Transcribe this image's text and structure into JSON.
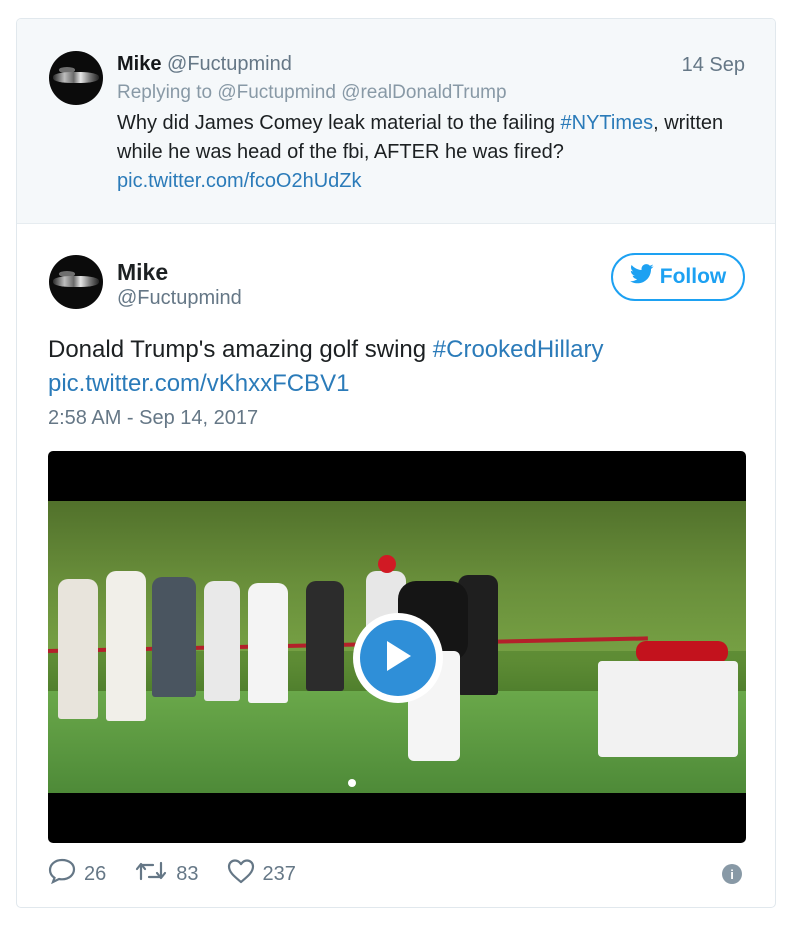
{
  "parent_tweet": {
    "name": "Mike",
    "handle": "@Fuctupmind",
    "date": "14 Sep",
    "replying_prefix": "Replying to",
    "replying_to_1": "@Fuctupmind",
    "replying_to_2": "@realDonaldTrump",
    "text_before": "Why did James Comey leak material to the failing ",
    "hashtag": "#NYTimes",
    "text_after": ", written while he was head of the fbi, AFTER he was fired?",
    "pic_link": "pic.twitter.com/fcoO2hUdZk"
  },
  "main_tweet": {
    "name": "Mike",
    "handle": "@Fuctupmind",
    "follow_label": "Follow",
    "text_before": "Donald Trump's amazing golf swing ",
    "hashtag": "#CrookedHillary",
    "pic_link": "pic.twitter.com/vKhxxFCBV1",
    "timestamp": "2:58 AM - Sep 14, 2017"
  },
  "actions": {
    "replies": "26",
    "retweets": "83",
    "likes": "237",
    "info_glyph": "i"
  },
  "colors": {
    "link": "#2b7bb9",
    "follow": "#1da1f2",
    "muted": "#657786",
    "play": "#2f8fd8"
  },
  "icons": [
    "twitter-bird-icon",
    "play-icon",
    "reply-icon",
    "retweet-icon",
    "like-icon",
    "info-icon"
  ]
}
